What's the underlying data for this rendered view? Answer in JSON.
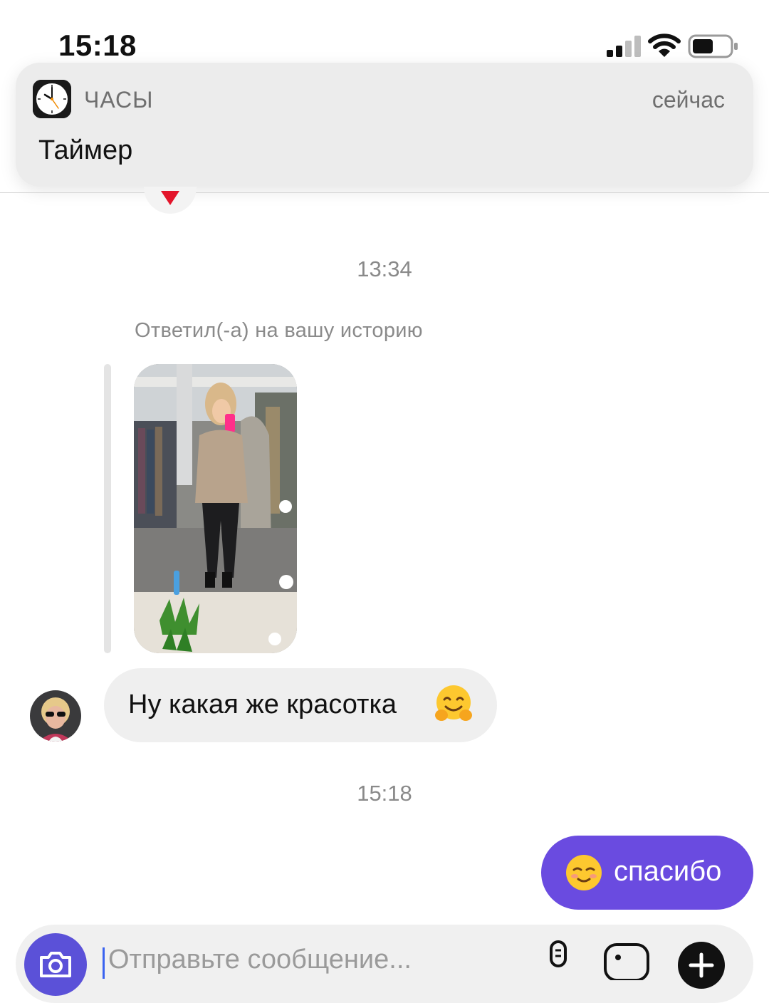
{
  "status_bar": {
    "time": "15:18",
    "icons": [
      "signal-icon",
      "wifi-icon",
      "battery-icon"
    ]
  },
  "notification": {
    "app_icon": "clock-icon",
    "app_name": "ЧАСЫ",
    "time": "сейчас",
    "title": "Таймер"
  },
  "chat": {
    "reaction_icon": "heart-icon",
    "timestamp_1": "13:34",
    "story_reply_label": "Ответил(-а) на вашу историю",
    "incoming_message": "Ну какая же красотка",
    "incoming_emoji": "hugging-face-emoji",
    "timestamp_2": "15:18",
    "outgoing_emoji": "smiling-face-emoji",
    "outgoing_message": "спасибо"
  },
  "composer": {
    "placeholder": "Отправьте сообщение...",
    "icons": [
      "camera-icon",
      "microphone-icon",
      "gallery-icon",
      "plus-icon"
    ]
  },
  "colors": {
    "accent": "#6a4be0",
    "camera_button": "#5b51d8",
    "incoming_bubble": "#efefef",
    "notification_bg": "#ececec"
  }
}
